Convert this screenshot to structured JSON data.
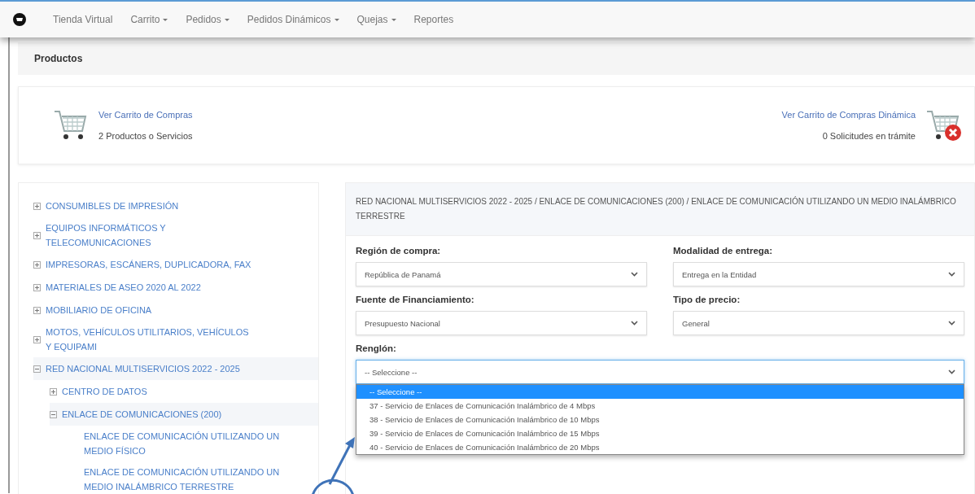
{
  "navbar": {
    "items": [
      {
        "label": "Tienda Virtual",
        "dropdown": false
      },
      {
        "label": "Carrito",
        "dropdown": true
      },
      {
        "label": "Pedidos",
        "dropdown": true
      },
      {
        "label": "Pedidos Dinámicos",
        "dropdown": true
      },
      {
        "label": "Quejas",
        "dropdown": true
      },
      {
        "label": "Reportes",
        "dropdown": false
      }
    ]
  },
  "page_title": "Productos",
  "cart": {
    "link": "Ver Carrito de Compras",
    "count": "2 Productos o Servicios"
  },
  "dynamic_cart": {
    "link": "Ver Carrito de Compras Dinámica",
    "count": "0 Solicitudes en trámite"
  },
  "tree": [
    {
      "label": "CONSUMIBLES DE IMPRESIÓN",
      "expanded": false
    },
    {
      "label": "EQUIPOS INFORMÁTICOS Y TELECOMUNICACIONES",
      "expanded": false
    },
    {
      "label": "IMPRESORAS, ESCÁNERS, DUPLICADORA, FAX",
      "expanded": false
    },
    {
      "label": "MATERIALES DE ASEO 2020 AL 2022",
      "expanded": false
    },
    {
      "label": "MOBILIARIO DE OFICINA",
      "expanded": false
    },
    {
      "label": "MOTOS, VEHÍCULOS UTILITARIOS, VEHÍCULOS Y EQUIPAMI",
      "expanded": false
    },
    {
      "label": "RED NACIONAL MULTISERVICIOS 2022 - 2025",
      "expanded": true,
      "children": [
        {
          "label": "CENTRO DE DATOS",
          "expanded": false
        },
        {
          "label": "ENLACE DE COMUNICACIONES (200)",
          "expanded": true,
          "children": [
            {
              "label": "ENLACE DE COMUNICACIÓN UTILIZANDO UN MEDIO FÍSICO"
            },
            {
              "label": "ENLACE DE COMUNICACIÓN UTILIZANDO UN MEDIO INALÁMBRICO TERRESTRE"
            }
          ]
        }
      ]
    }
  ],
  "breadcrumb": "RED NACIONAL MULTISERVICIOS 2022 - 2025 / ENLACE DE COMUNICACIONES (200) / ENLACE DE COMUNICACIÓN UTILIZANDO UN MEDIO INALÁMBRICO TERRESTRE",
  "fields": [
    {
      "label": "Región de compra:",
      "value": "República de Panamá"
    },
    {
      "label": "Modalidad de entrega:",
      "value": "Entrega en la Entidad"
    },
    {
      "label": "Fuente de Financiamiento:",
      "value": "Presupuesto Nacional"
    },
    {
      "label": "Tipo de precio:",
      "value": "General"
    }
  ],
  "renglon": {
    "label": "Renglón:",
    "value": "-- Seleccione --",
    "expanded": true,
    "options": [
      {
        "label": "-- Seleccione --",
        "selected": true
      },
      {
        "label": "37 - Servicio de Enlaces de Comunicación Inalámbrico de 4 Mbps",
        "selected": false
      },
      {
        "label": "38 - Servicio de Enlaces de Comunicación Inalámbrico de 10 Mbps",
        "selected": false
      },
      {
        "label": "39 - Servicio de Enlaces de Comunicación Inalámbrico de 15 Mbps",
        "selected": false
      },
      {
        "label": "40 - Servicio de Enlaces de Comunicación Inalámbrico de 20 Mbps",
        "selected": false
      }
    ]
  }
}
